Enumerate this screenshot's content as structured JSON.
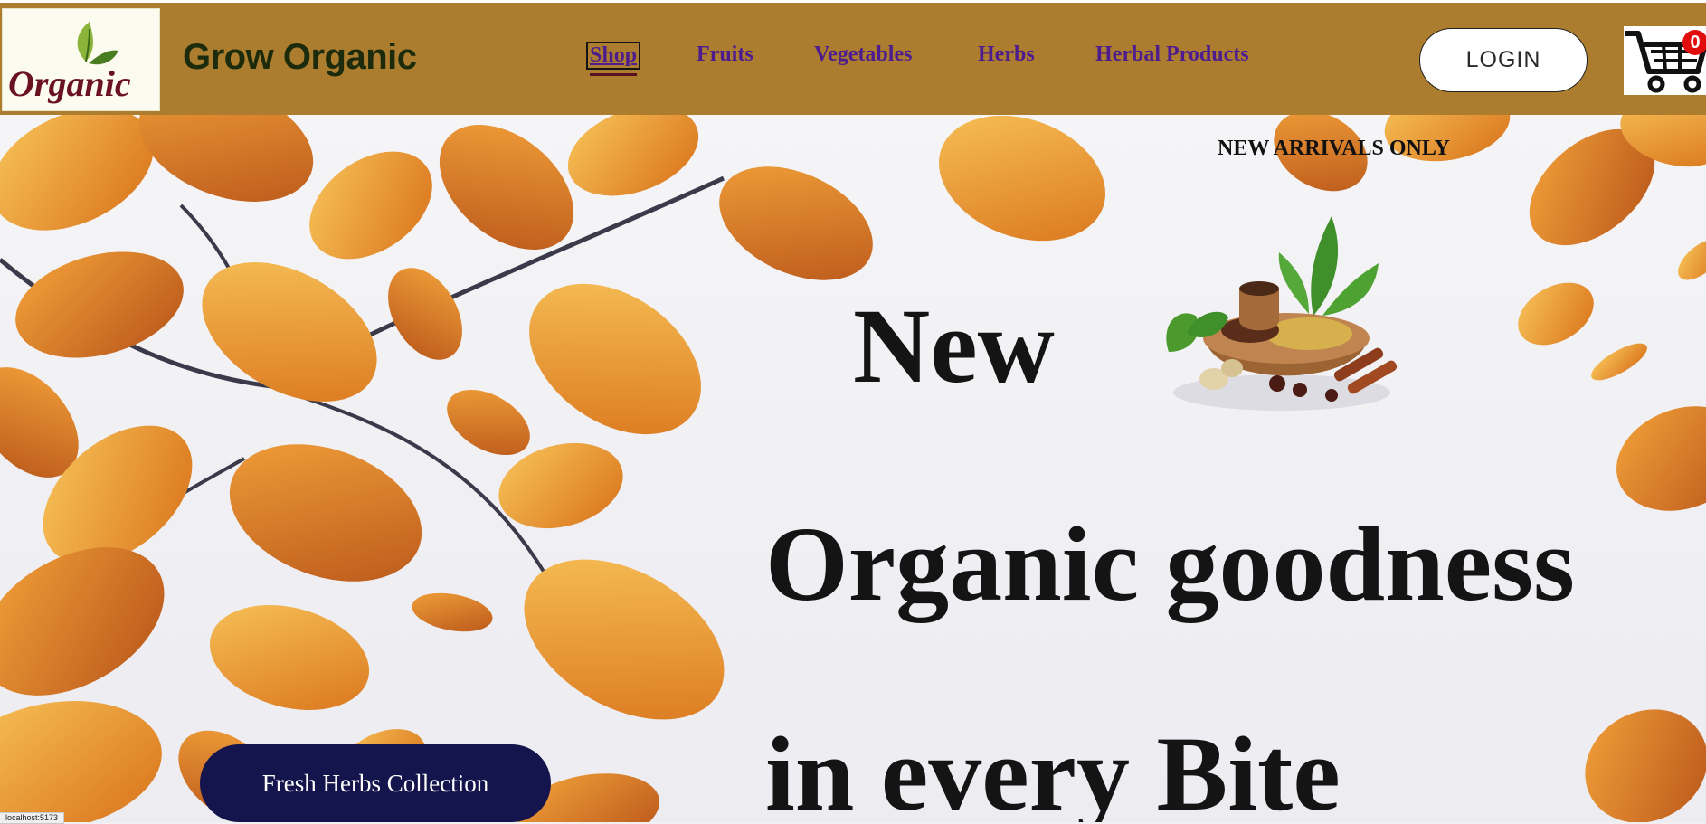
{
  "brand": {
    "name": "Grow Organic",
    "logo_text": "Organic"
  },
  "nav": {
    "items": [
      {
        "label": "Shop",
        "active": true
      },
      {
        "label": "Fruits"
      },
      {
        "label": "Vegetables"
      },
      {
        "label": "Herbs"
      },
      {
        "label": "Herbal Products"
      }
    ]
  },
  "header": {
    "login_label": "LOGIN",
    "cart_count": "0",
    "cart_icon": "cart-icon"
  },
  "hero": {
    "tagline": "NEW ARRIVALS ONLY",
    "headline_line1": "New",
    "headline_line2": "Organic goodness",
    "headline_line3": "in every Bite",
    "cta_label": "Fresh Herbs Collection"
  },
  "colors": {
    "header_bg": "#ad7d2f",
    "nav_link": "#4d1d8d",
    "cta_bg": "#15154d",
    "cart_badge": "#e10d0d"
  },
  "status_bar": {
    "url": "localhost:5173"
  }
}
